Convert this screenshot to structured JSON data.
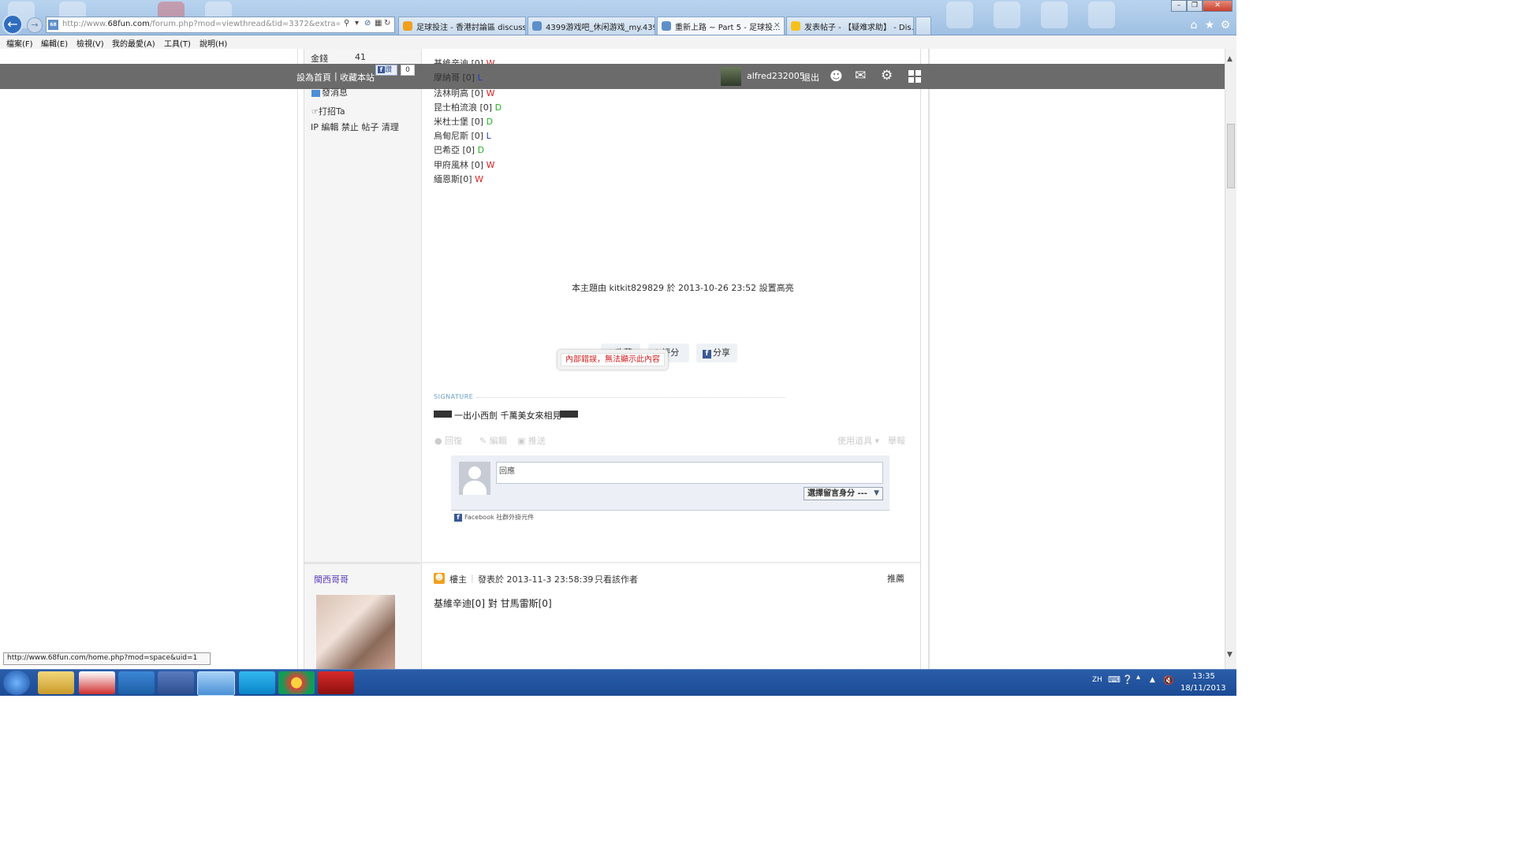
{
  "browser": {
    "address_prefix": "http://www.",
    "address_domain": "68fun.com",
    "address_rest": "/forum.php?mod=viewthread&tid=3372&extra=page",
    "tabs": [
      {
        "title": "足球投注 - 香港討論區 discuss...",
        "color": "#f0a020"
      },
      {
        "title": "4399游戏吧_休闲游戏_my.439...",
        "color": "#5f8fc9"
      },
      {
        "title": "重新上路 ~ Part 5 - 足球投...",
        "color": "#5f8fc9",
        "active": true,
        "close": "×"
      },
      {
        "title": "发表帖子 - 【疑难求助】 - Dis...",
        "color": "#f6c11b"
      }
    ],
    "menu": [
      "檔案(F)",
      "編輯(E)",
      "檢視(V)",
      "我的最愛(A)",
      "工具(T)",
      "說明(H)"
    ],
    "status_url": "http://www.68fun.com/home.php?mod=space&uid=1"
  },
  "site_bar": {
    "set_home": "設為首頁",
    "separator": "|",
    "bookmark": "收藏本站",
    "fb_like": "讚",
    "fb_count": "0",
    "username": "alfred232005",
    "logout": "退出"
  },
  "profile": {
    "gold_label": "金錢",
    "gold_value": "41",
    "send_msg": "發消息",
    "greet": "打招Ta",
    "admin_links": "IP 編輯 禁止 帖子 清理"
  },
  "post1": {
    "results": [
      {
        "team": "基維辛迪 [0]",
        "r": "W",
        "cls": "w"
      },
      {
        "team": "摩納哥 [0]",
        "r": "L",
        "cls": "l"
      },
      {
        "team": "法林明高 [0]",
        "r": "W",
        "cls": "w"
      },
      {
        "team": "昆士柏流浪 [0]",
        "r": "D",
        "cls": "d"
      },
      {
        "team": "米杜士堡 [0]",
        "r": "D",
        "cls": "d"
      },
      {
        "team": "烏甸尼斯 [0]",
        "r": "L",
        "cls": "l"
      },
      {
        "team": "巴希亞 [0]",
        "r": "D",
        "cls": "d"
      },
      {
        "team": "甲府風林 [0]",
        "r": "W",
        "cls": "w"
      },
      {
        "team": "緬恩斯[0]",
        "r": "W",
        "cls": "w"
      }
    ],
    "highlight_note": "本主題由 kitkit829829 於 2013-10-26 23:52 設置高亮",
    "collect": "收藏",
    "rate": "評分",
    "share": "分享",
    "error_popup": "內部錯誤，無法顯示此內容",
    "signature_label": "SIGNATURE",
    "signature_text": "一出小西劍 千萬美女來相見",
    "reply": "回復",
    "edit": "編輯",
    "push": "推送",
    "use_tool": "使用道具",
    "report": "舉報",
    "fb_comment_placeholder": "回應",
    "fb_identity": "選擇留言身分 ---",
    "fb_plugin": "Facebook 社群外掛元件"
  },
  "post2": {
    "author": "閩西哥哥",
    "owner_label": "樓主",
    "posted": "發表於 2013-11-3 23:58:39",
    "only_author": "只看該作者",
    "recommend": "推薦",
    "body": "基維辛迪[0] 對 甘馬雷斯[0]"
  },
  "taskbar": {
    "ime": "ZH",
    "time": "13:35",
    "date": "18/11/2013"
  }
}
